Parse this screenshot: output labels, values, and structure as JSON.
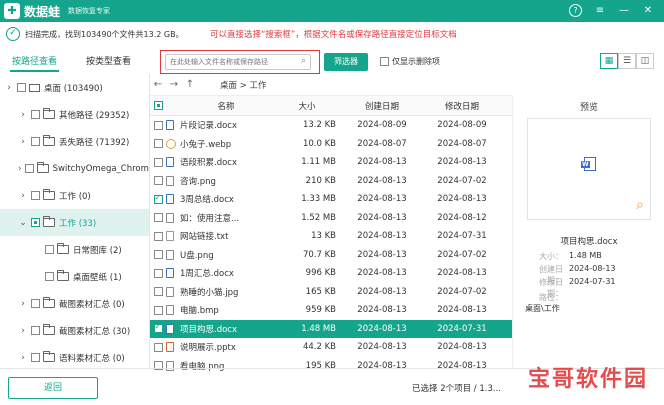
{
  "titlebar": {
    "logo": "✚",
    "app_name": "数据蛙",
    "tagline": "数据恢复专家",
    "help": "?",
    "menu": "≡",
    "minimize": "—",
    "close": "✕"
  },
  "status": {
    "text": "扫描完成，找到103490个文件共13.2 GB。",
    "annotation": "可以直接选择“搜索框”，根据文件名或保存路径直接定位目标文档"
  },
  "tabs": {
    "by_path": "按路径查看",
    "by_type": "按类型查看"
  },
  "search": {
    "placeholder": "在此处输入文件名称或保存路径",
    "icon": "⌕"
  },
  "filter_label": "筛选器",
  "deleted_only_label": "仅显示删除项",
  "view_buttons": [
    "▦",
    "☰",
    "◫"
  ],
  "tree": [
    {
      "chev": "›",
      "label": "桌面 (103490)",
      "kind": "monitor",
      "indent": 0
    },
    {
      "chev": "›",
      "label": "其他路径 (29352)",
      "kind": "folder",
      "indent": 1
    },
    {
      "chev": "›",
      "label": "丢失路径 (71392)",
      "kind": "folder",
      "indent": 1
    },
    {
      "chev": "›",
      "label": "SwitchyOmega_Chromium",
      "kind": "folder",
      "indent": 1
    },
    {
      "chev": "›",
      "label": "工作 (0)",
      "kind": "folder",
      "indent": 1
    },
    {
      "chev": "⌄",
      "label": "工作 (33)",
      "kind": "folder",
      "indent": 1
    },
    {
      "chev": "",
      "label": "日常图库 (2)",
      "kind": "folder",
      "indent": 2
    },
    {
      "chev": "",
      "label": "桌面壁纸 (1)",
      "kind": "folder",
      "indent": 2
    },
    {
      "chev": "›",
      "label": "截图素材汇总 (0)",
      "kind": "folder",
      "indent": 1
    },
    {
      "chev": "›",
      "label": "截图素材汇总 (30)",
      "kind": "folder",
      "indent": 1
    },
    {
      "chev": "›",
      "label": "语料素材汇总 (0)",
      "kind": "folder",
      "indent": 1
    }
  ],
  "nav": {
    "back": "←",
    "forward": "→",
    "up": "↑",
    "path": "桌面 > 工作"
  },
  "table": {
    "headers": {
      "name": "名称",
      "size": "大小",
      "created": "创建日期",
      "modified": "修改日期"
    },
    "rows": [
      {
        "name": "片段记录.docx",
        "size": "13.2 KB",
        "created": "2024-08-09",
        "modified": "2024-08-09",
        "icon": "doc"
      },
      {
        "name": "小兔子.webp",
        "size": "10.0 KB",
        "created": "2024-08-07",
        "modified": "2024-08-07",
        "icon": "web"
      },
      {
        "name": "语段积累.docx",
        "size": "1.11 MB",
        "created": "2024-08-13",
        "modified": "2024-08-13",
        "icon": "doc"
      },
      {
        "name": "咨询.png",
        "size": "210 KB",
        "created": "2024-08-13",
        "modified": "2024-07-02",
        "icon": "img"
      },
      {
        "name": "3周总结.docx",
        "size": "1.33 MB",
        "created": "2024-08-13",
        "modified": "2024-08-13",
        "icon": "doc"
      },
      {
        "name": "如：使用注意...",
        "size": "1.52 MB",
        "created": "2024-08-13",
        "modified": "2024-08-12",
        "icon": "img"
      },
      {
        "name": "网站链接.txt",
        "size": "13 KB",
        "created": "2024-08-13",
        "modified": "2024-07-31",
        "icon": "txt"
      },
      {
        "name": "U盘.png",
        "size": "70.7 KB",
        "created": "2024-08-13",
        "modified": "2024-07-02",
        "icon": "img"
      },
      {
        "name": "1周汇总.docx",
        "size": "996 KB",
        "created": "2024-08-13",
        "modified": "2024-08-13",
        "icon": "doc"
      },
      {
        "name": "熟睡的小猫.jpg",
        "size": "165 KB",
        "created": "2024-08-13",
        "modified": "2024-07-02",
        "icon": "img"
      },
      {
        "name": "电脑.bmp",
        "size": "959 KB",
        "created": "2024-08-13",
        "modified": "2024-08-13",
        "icon": "img"
      },
      {
        "name": "项目构思.docx",
        "size": "1.48 MB",
        "created": "2024-08-13",
        "modified": "2024-07-31",
        "icon": "doc"
      },
      {
        "name": "说明展示.pptx",
        "size": "44.2 KB",
        "created": "2024-08-13",
        "modified": "2024-08-13",
        "icon": "ppt"
      },
      {
        "name": "看电脑.png",
        "size": "195 KB",
        "created": "2024-08-13",
        "modified": "2024-08-13",
        "icon": "img"
      }
    ]
  },
  "preview": {
    "title": "预览",
    "file_name": "项目构思.docx",
    "size_label": "大小：",
    "size": "1.48 MB",
    "created_label": "创建日期：",
    "created": "2024-08-13",
    "modified_label": "修改日期：",
    "modified": "2024-07-31",
    "location_label": "路径：",
    "location": "桌面\\工作"
  },
  "bottom": {
    "back_label": "返回",
    "selection_info": "已选择 2个项目 / 1.3..."
  },
  "watermark": "宝哥软件园"
}
